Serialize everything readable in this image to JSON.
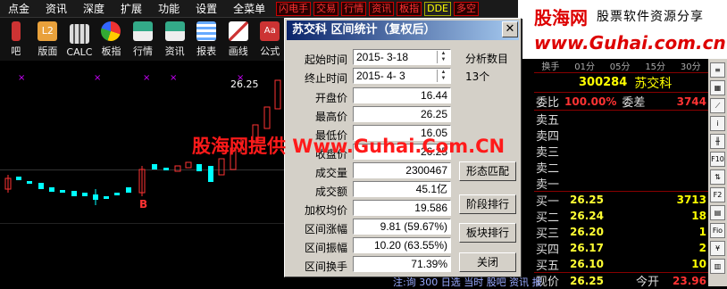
{
  "menubar": {
    "items": [
      "点金",
      "资讯",
      "深度",
      "扩展",
      "功能",
      "设置",
      "全菜单"
    ],
    "tags": [
      "闪电手",
      "交易",
      "行情",
      "资讯",
      "板指",
      "DDE",
      "多空"
    ]
  },
  "toolbar": {
    "items": [
      {
        "label": "吧",
        "icon": "chat-icon"
      },
      {
        "label": "版面",
        "icon": "l2-icon"
      },
      {
        "label": "CALC",
        "icon": "calculator-icon"
      },
      {
        "label": "板指",
        "icon": "pie-icon"
      },
      {
        "label": "行情",
        "icon": "quote-icon"
      },
      {
        "label": "资讯",
        "icon": "news-icon"
      },
      {
        "label": "报表",
        "icon": "report-icon"
      },
      {
        "label": "画线",
        "icon": "draw-icon"
      },
      {
        "label": "公式",
        "icon": "formula-icon"
      }
    ]
  },
  "brand": {
    "name": "股海网",
    "slogan": "股票软件资源分享",
    "url": "www.Guhai.com.cn"
  },
  "chart": {
    "high_label": "26.25",
    "marker": "B"
  },
  "watermark": "股海网提供 Www.Guhai.Com.CN",
  "dialog": {
    "title": "苏交科  区间统计（复权后）",
    "close": "✕",
    "start_label": "起始时间",
    "start_value": "2015- 3-18",
    "end_label": "终止时间",
    "end_value": "2015- 4- 3",
    "analysis_label": "分析数目",
    "analysis_value": "13个",
    "rows": [
      {
        "label": "开盘价",
        "value": "16.44"
      },
      {
        "label": "最高价",
        "value": "26.25"
      },
      {
        "label": "最低价",
        "value": "16.05"
      },
      {
        "label": "收盘价",
        "value": "26.25"
      },
      {
        "label": "成交量",
        "value": "2300467"
      },
      {
        "label": "成交额",
        "value": "45.1亿"
      },
      {
        "label": "加权均价",
        "value": "19.586"
      },
      {
        "label": "区间涨幅",
        "value": "9.81 (59.67%)"
      },
      {
        "label": "区间振幅",
        "value": "10.20 (63.55%)"
      },
      {
        "label": "区间换手",
        "value": "71.39%"
      }
    ],
    "buttons": [
      "形态匹配",
      "阶段排行",
      "板块排行",
      "关闭"
    ]
  },
  "right_panel": {
    "tabs": [
      "换手",
      "01分",
      "05分",
      "15分",
      "30分"
    ],
    "code": "300284",
    "name": "苏交科",
    "weibi_label": "委比",
    "weibi_value": "100.00%",
    "weicha_label": "委差",
    "weicha_value": "3744",
    "sell": [
      "卖五",
      "卖四",
      "卖三",
      "卖二",
      "卖一"
    ],
    "buy": [
      {
        "label": "买一",
        "price": "26.25",
        "vol": "3713"
      },
      {
        "label": "买二",
        "price": "26.24",
        "vol": "18"
      },
      {
        "label": "买三",
        "price": "26.20",
        "vol": "1"
      },
      {
        "label": "买四",
        "price": "26.17",
        "vol": "2"
      },
      {
        "label": "买五",
        "price": "26.10",
        "vol": "10"
      }
    ],
    "last_label": "现价",
    "last_price": "26.25",
    "open_label": "今开",
    "open_value": "23.96"
  },
  "side_icons": [
    "F10",
    "F2",
    "Fio"
  ],
  "bottom_text": "注:询 300 日选 当时 股吧 资讯 报"
}
